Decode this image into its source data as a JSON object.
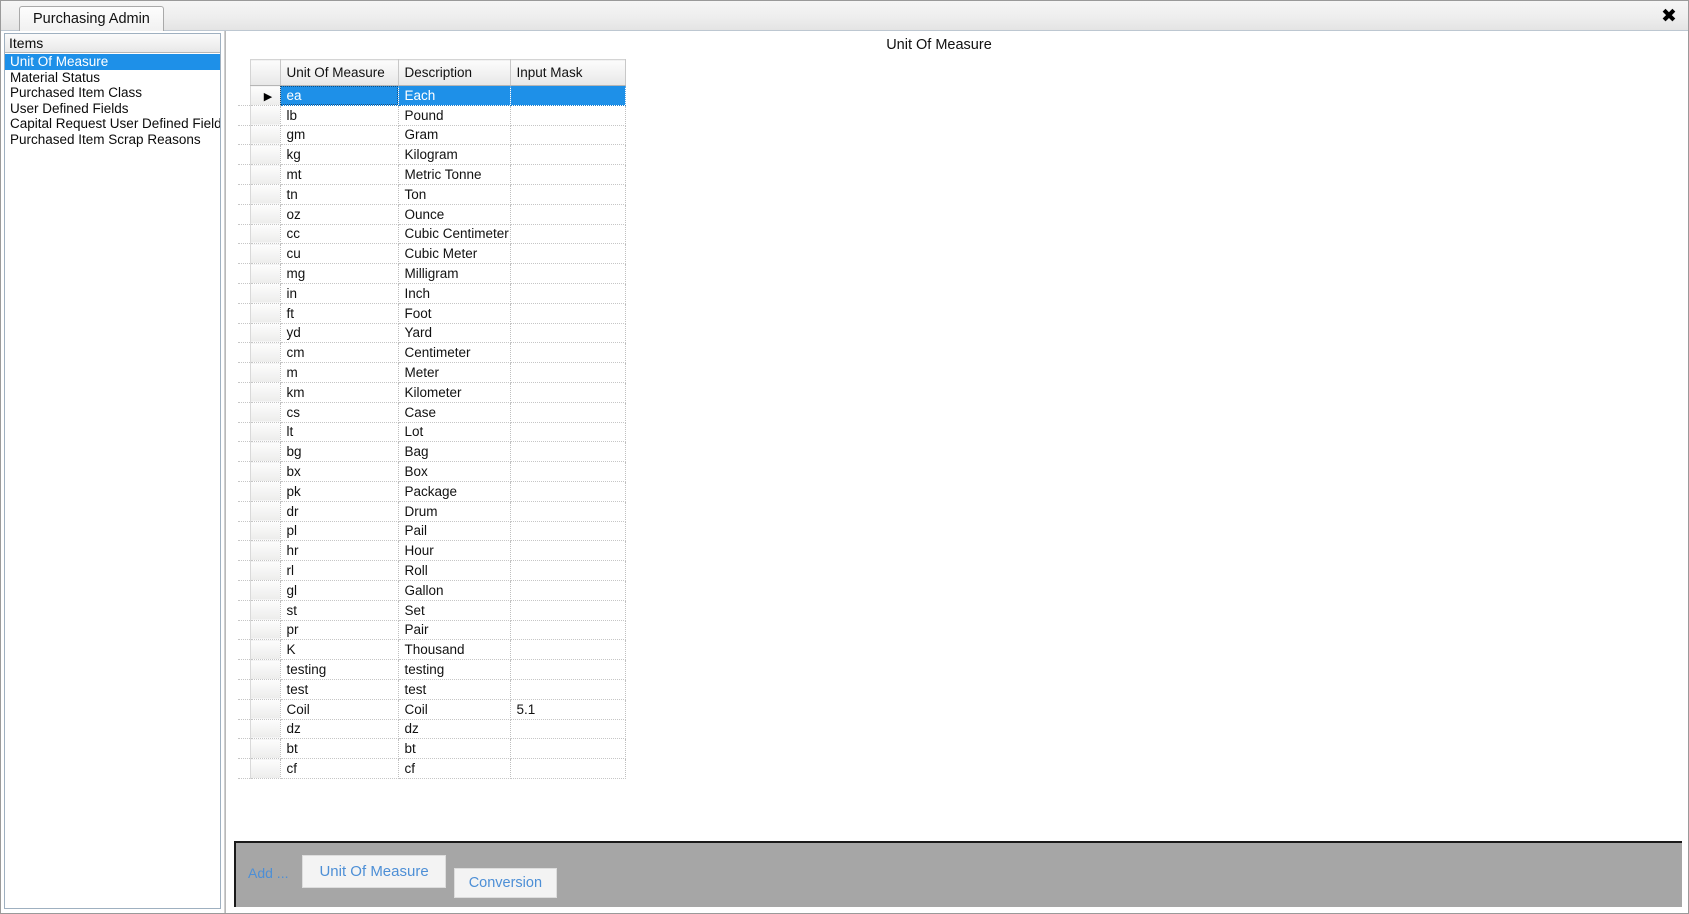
{
  "window": {
    "tab_label": "Purchasing Admin",
    "close_icon": "close-icon",
    "close_glyph": "✖"
  },
  "sidebar": {
    "header": "Items",
    "items": [
      {
        "label": "Unit Of Measure",
        "selected": true
      },
      {
        "label": "Material Status",
        "selected": false
      },
      {
        "label": "Purchased Item Class",
        "selected": false
      },
      {
        "label": "User Defined Fields",
        "selected": false
      },
      {
        "label": "Capital Request User Defined Fields",
        "selected": false
      },
      {
        "label": "Purchased Item Scrap Reasons",
        "selected": false
      }
    ]
  },
  "main": {
    "title": "Unit Of Measure",
    "grid": {
      "row_marker_glyph": "▶",
      "columns": [
        "Unit Of Measure",
        "Description",
        "Input Mask"
      ],
      "rows": [
        {
          "uom": "ea",
          "description": "Each",
          "mask": "",
          "selected": true
        },
        {
          "uom": "lb",
          "description": "Pound",
          "mask": "",
          "selected": false
        },
        {
          "uom": "gm",
          "description": "Gram",
          "mask": "",
          "selected": false
        },
        {
          "uom": "kg",
          "description": "Kilogram",
          "mask": "",
          "selected": false
        },
        {
          "uom": "mt",
          "description": "Metric Tonne",
          "mask": "",
          "selected": false
        },
        {
          "uom": "tn",
          "description": "Ton",
          "mask": "",
          "selected": false
        },
        {
          "uom": "oz",
          "description": "Ounce",
          "mask": "",
          "selected": false
        },
        {
          "uom": "cc",
          "description": "Cubic Centimeter",
          "mask": "",
          "selected": false
        },
        {
          "uom": "cu",
          "description": "Cubic Meter",
          "mask": "",
          "selected": false
        },
        {
          "uom": "mg",
          "description": "Milligram",
          "mask": "",
          "selected": false
        },
        {
          "uom": "in",
          "description": "Inch",
          "mask": "",
          "selected": false
        },
        {
          "uom": "ft",
          "description": "Foot",
          "mask": "",
          "selected": false
        },
        {
          "uom": "yd",
          "description": "Yard",
          "mask": "",
          "selected": false
        },
        {
          "uom": "cm",
          "description": "Centimeter",
          "mask": "",
          "selected": false
        },
        {
          "uom": "m",
          "description": "Meter",
          "mask": "",
          "selected": false
        },
        {
          "uom": "km",
          "description": "Kilometer",
          "mask": "",
          "selected": false
        },
        {
          "uom": "cs",
          "description": "Case",
          "mask": "",
          "selected": false
        },
        {
          "uom": "lt",
          "description": "Lot",
          "mask": "",
          "selected": false
        },
        {
          "uom": "bg",
          "description": "Bag",
          "mask": "",
          "selected": false
        },
        {
          "uom": "bx",
          "description": "Box",
          "mask": "",
          "selected": false
        },
        {
          "uom": "pk",
          "description": "Package",
          "mask": "",
          "selected": false
        },
        {
          "uom": "dr",
          "description": "Drum",
          "mask": "",
          "selected": false
        },
        {
          "uom": "pl",
          "description": "Pail",
          "mask": "",
          "selected": false
        },
        {
          "uom": "hr",
          "description": "Hour",
          "mask": "",
          "selected": false
        },
        {
          "uom": "rl",
          "description": "Roll",
          "mask": "",
          "selected": false
        },
        {
          "uom": "gl",
          "description": "Gallon",
          "mask": "",
          "selected": false
        },
        {
          "uom": "st",
          "description": "Set",
          "mask": "",
          "selected": false
        },
        {
          "uom": "pr",
          "description": "Pair",
          "mask": "",
          "selected": false
        },
        {
          "uom": "K",
          "description": "Thousand",
          "mask": "",
          "selected": false
        },
        {
          "uom": "testing",
          "description": "testing",
          "mask": "",
          "selected": false
        },
        {
          "uom": "test",
          "description": "test",
          "mask": "",
          "selected": false
        },
        {
          "uom": "Coil",
          "description": "Coil",
          "mask": "5.1",
          "selected": false
        },
        {
          "uom": "dz",
          "description": "dz",
          "mask": "",
          "selected": false
        },
        {
          "uom": "bt",
          "description": "bt",
          "mask": "",
          "selected": false
        },
        {
          "uom": "cf",
          "description": "cf",
          "mask": "",
          "selected": false
        }
      ]
    }
  },
  "footer": {
    "add_label": "Add ...",
    "buttons": [
      {
        "label": "Unit Of Measure"
      },
      {
        "label": "Conversion"
      }
    ]
  },
  "colors": {
    "selection_blue": "#1e90e8",
    "link_blue": "#4d8fd6",
    "footer_gray": "#a6a6a6"
  }
}
